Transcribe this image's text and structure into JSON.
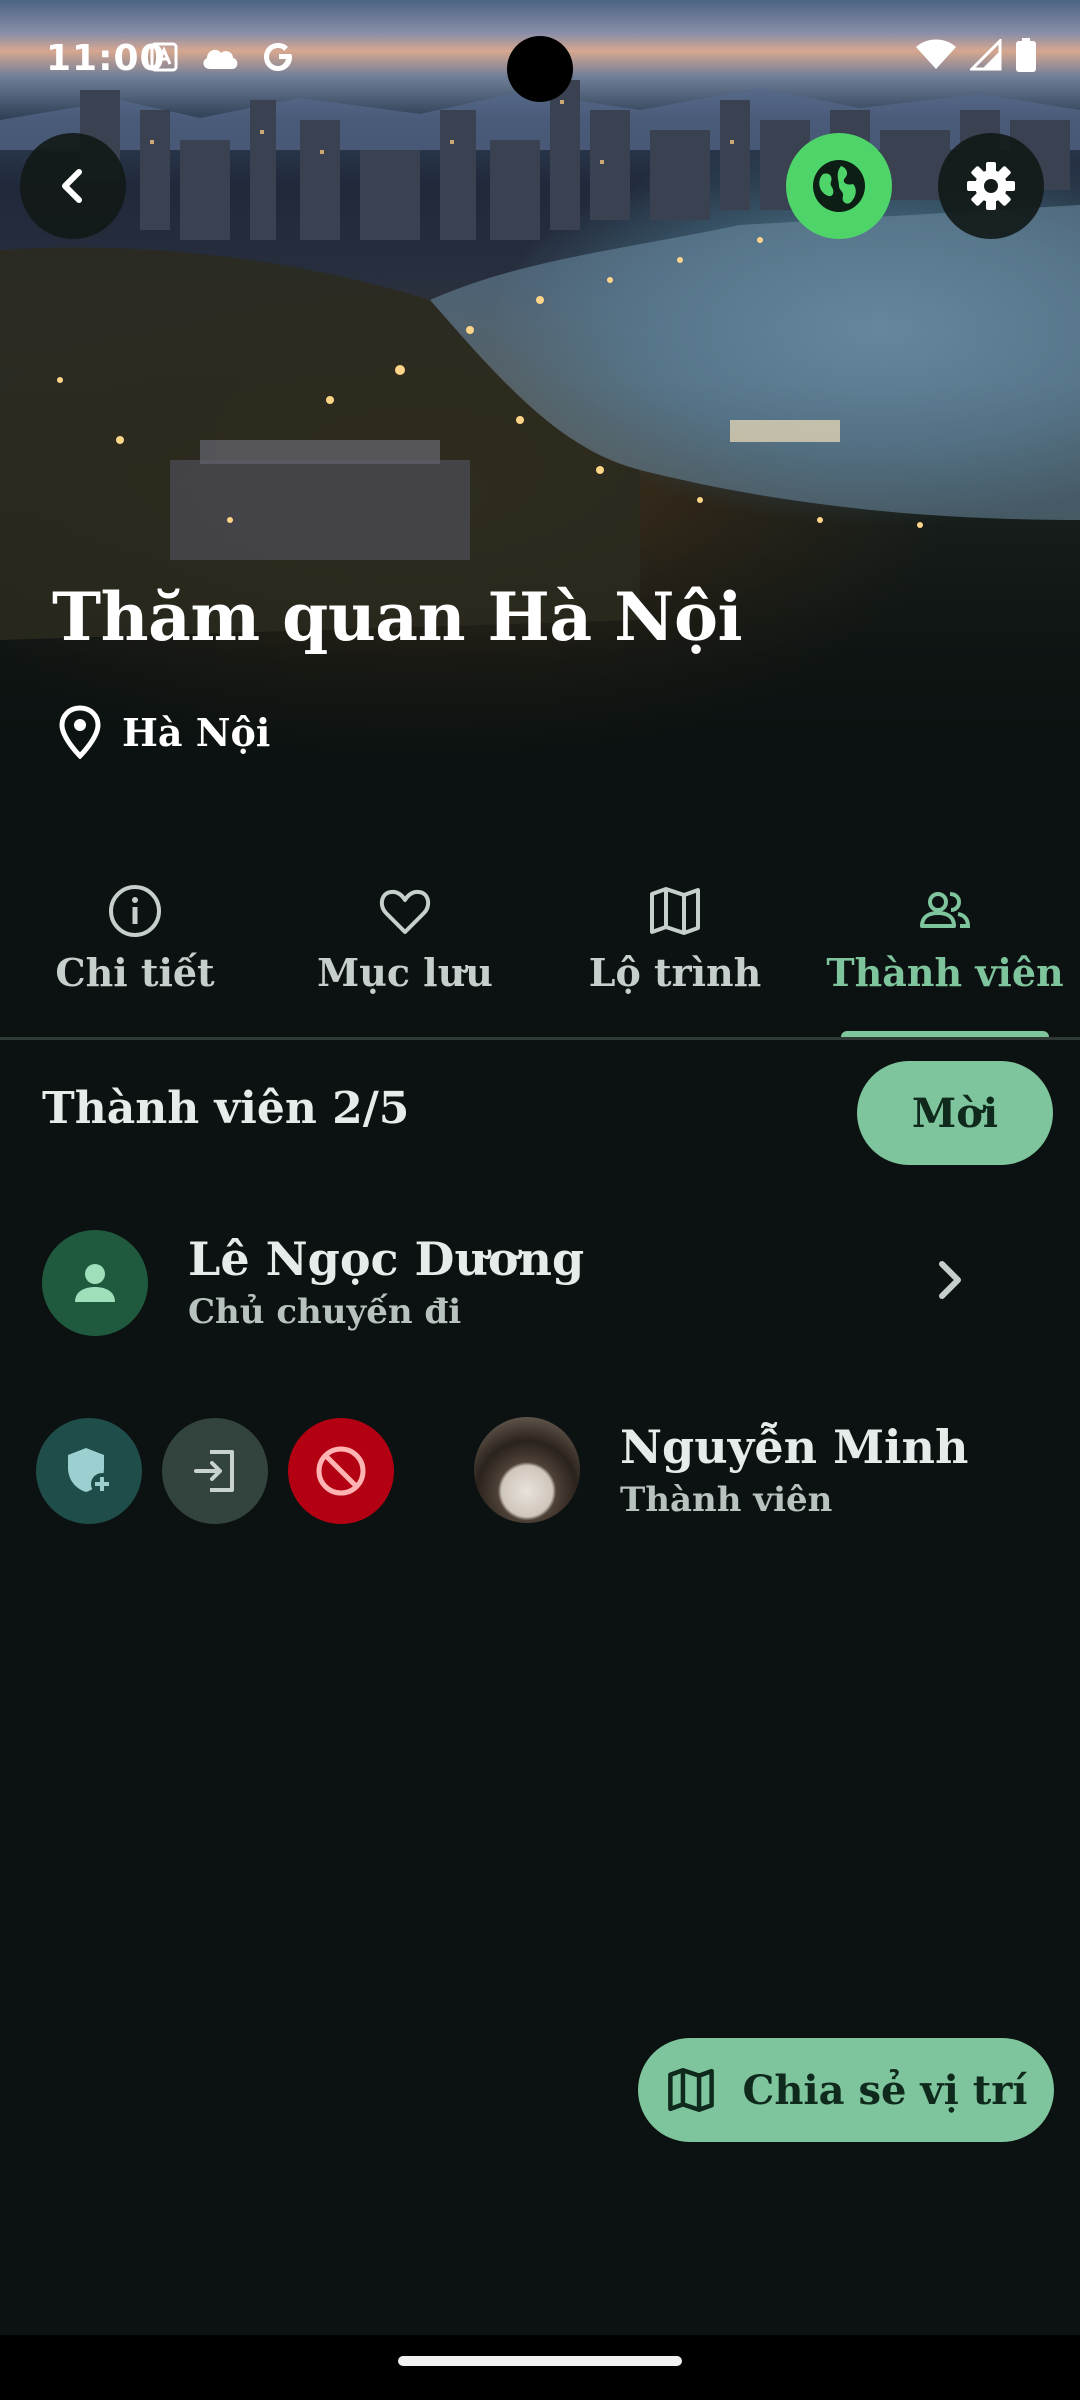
{
  "status_bar": {
    "time": "11:00",
    "icons": [
      "notification-a-icon",
      "cloud-icon",
      "google-icon",
      "wifi-icon",
      "signal-icon",
      "battery-icon"
    ]
  },
  "header": {
    "back_icon": "chevron-left-icon",
    "globe_icon": "globe-icon",
    "settings_icon": "gear-icon"
  },
  "trip": {
    "title": "Thăm quan Hà Nội",
    "location": "Hà Nội"
  },
  "tabs": [
    {
      "label": "Chi tiết",
      "icon": "info-icon",
      "active": false
    },
    {
      "label": "Mục lưu",
      "icon": "heart-icon",
      "active": false
    },
    {
      "label": "Lộ trình",
      "icon": "map-icon",
      "active": false
    },
    {
      "label": "Thành viên",
      "icon": "group-icon",
      "active": true
    }
  ],
  "members": {
    "header": "Thành viên 2/5",
    "invite_label": "Mời",
    "list": [
      {
        "name": "Lê Ngọc Dương",
        "role": "Chủ chuyến đi"
      },
      {
        "name": "Nguyễn Minh",
        "role": "Thành viên"
      }
    ]
  },
  "share_location": {
    "label": "Chia sẻ vị trí"
  },
  "colors": {
    "accent": "#7ec49c",
    "background": "#0c1211",
    "globe_button": "#4fd46a",
    "block_button": "#b30012"
  }
}
